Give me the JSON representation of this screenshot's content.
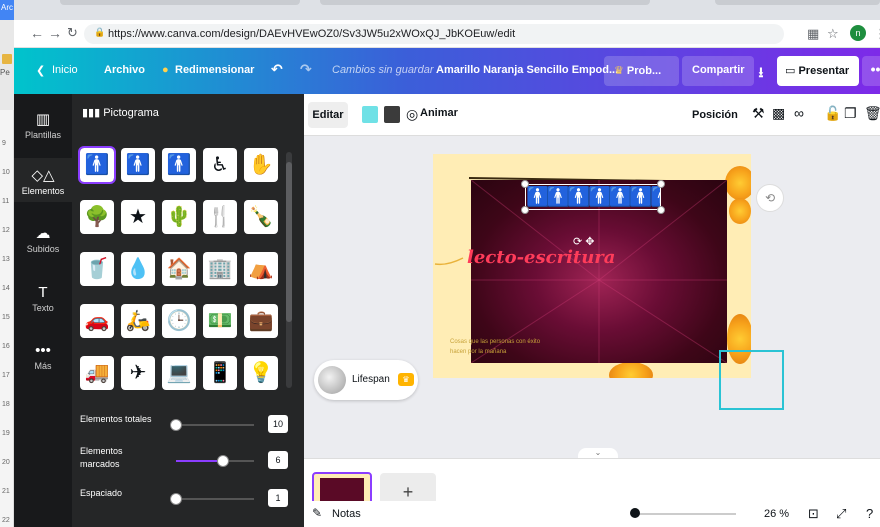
{
  "browser": {
    "tab_fragment": "Arc",
    "left_strip_label": "Pe",
    "url": "https://www.canva.com/design/DAEvHVEwOZ0/Sv3JW5u2xWOxQJ_JbKOEuw/edit",
    "profile_initial": "n"
  },
  "topbar": {
    "inicio": "Inicio",
    "archivo": "Archivo",
    "redimensionar": "Redimensionar",
    "status": "Cambios sin guardar",
    "doc_title": "Amarillo Naranja Sencillo Empod...",
    "prob": "Prob...",
    "compartir": "Compartir",
    "presentar": "Presentar"
  },
  "side_rail": [
    {
      "label": "Plantillas"
    },
    {
      "label": "Elementos"
    },
    {
      "label": "Subidos"
    },
    {
      "label": "Texto"
    },
    {
      "label": "Más"
    }
  ],
  "panel": {
    "title": "Pictograma",
    "icons": [
      {
        "glyph": "🚹",
        "icon": "person-icon"
      },
      {
        "glyph": "🚹",
        "icon": "person-walking-icon"
      },
      {
        "glyph": "🚹",
        "icon": "man-icon"
      },
      {
        "glyph": "♿",
        "icon": "accessible-person-icon"
      },
      {
        "glyph": "✋",
        "icon": "hand-icon"
      },
      {
        "glyph": "🌳",
        "icon": "tree-icon"
      },
      {
        "glyph": "★",
        "icon": "star-icon"
      },
      {
        "glyph": "🌵",
        "icon": "cactus-icon"
      },
      {
        "glyph": "🍴",
        "icon": "cutlery-icon"
      },
      {
        "glyph": "🍾",
        "icon": "bottle-icon"
      },
      {
        "glyph": "🥤",
        "icon": "cup-icon"
      },
      {
        "glyph": "💧",
        "icon": "drop-icon"
      },
      {
        "glyph": "🏠",
        "icon": "house-icon"
      },
      {
        "glyph": "🏢",
        "icon": "building-icon"
      },
      {
        "glyph": "⛺",
        "icon": "tent-icon"
      },
      {
        "glyph": "🚗",
        "icon": "car-icon"
      },
      {
        "glyph": "🛵",
        "icon": "scooter-icon"
      },
      {
        "glyph": "🕒",
        "icon": "clock-icon"
      },
      {
        "glyph": "💵",
        "icon": "banknote-icon"
      },
      {
        "glyph": "💼",
        "icon": "briefcase-icon"
      },
      {
        "glyph": "🚚",
        "icon": "truck-icon"
      },
      {
        "glyph": "✈",
        "icon": "airplane-icon"
      },
      {
        "glyph": "💻",
        "icon": "laptop-icon"
      },
      {
        "glyph": "📱",
        "icon": "phone-icon"
      },
      {
        "glyph": "💡",
        "icon": "lightbulb-icon"
      }
    ],
    "sliders": [
      {
        "label": "Elementos totales",
        "value": "10",
        "fraction": 0.0
      },
      {
        "label": "Elementos marcados",
        "value": "6",
        "fraction": 0.6
      },
      {
        "label": "Espaciado",
        "value": "1",
        "fraction": 0.0
      }
    ]
  },
  "toolbar": {
    "editar": "Editar",
    "animar": "Animar",
    "posicion": "Posición",
    "swatch_colors": [
      "#6fe1e6",
      "#3b3b3b"
    ]
  },
  "design": {
    "title_text": "lecto-escritura",
    "caption": "Cosas que las personas con éxito hacen por la mañana",
    "marked_count": 6,
    "total_count": 10
  },
  "lifespan": {
    "label": "Lifespan"
  },
  "thumbnails": {
    "page_number": "1",
    "add": "+"
  },
  "bottom": {
    "notas": "Notas",
    "zoom": "26 %",
    "help": "?"
  },
  "ruler": [
    "9",
    "10",
    "11",
    "12",
    "13",
    "14",
    "15",
    "16",
    "17",
    "18",
    "19",
    "20",
    "21",
    "22"
  ],
  "colors": {
    "accent": "#8b3dff",
    "marked": "#6fe1e6",
    "selection": "#2ac3d4"
  }
}
